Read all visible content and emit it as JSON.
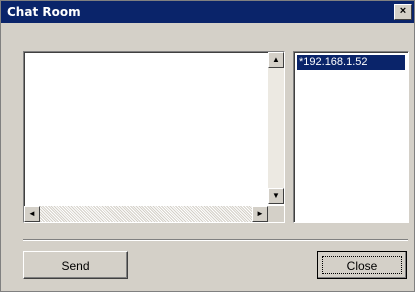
{
  "window": {
    "title": "Chat Room",
    "close_glyph": "×"
  },
  "chat": {
    "messages_text": ""
  },
  "users": {
    "items": [
      "*192.168.1.52"
    ]
  },
  "buttons": {
    "send": "Send",
    "close": "Close"
  },
  "icons": {
    "scroll_up": "▲",
    "scroll_down": "▼",
    "scroll_left": "◄",
    "scroll_right": "►"
  },
  "colors": {
    "titlebar": "#0a246a",
    "window": "#d4d0c8",
    "selection": "#0a246a"
  }
}
